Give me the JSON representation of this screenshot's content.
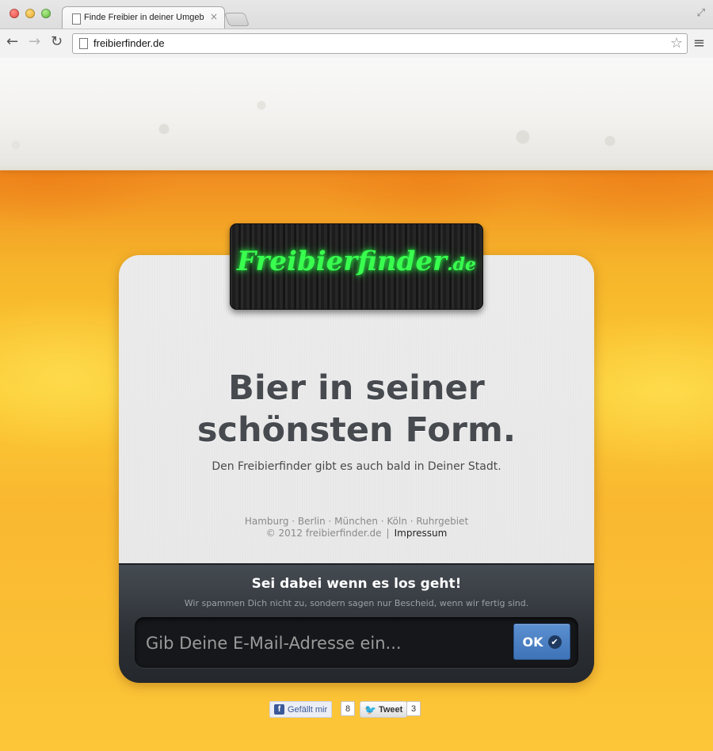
{
  "browser": {
    "tab_title": "Finde Freibier in deiner Umgebung",
    "tab_close": "×",
    "url": "freibierfinder.de"
  },
  "logo": {
    "name": "Freibierfinder",
    "tld": ".de",
    "color": "#39ff4f"
  },
  "hero": {
    "headline_line1": "Bier in seiner",
    "headline_line2": "schönsten Form.",
    "subline": "Den Freibierfinder gibt es auch bald in Deiner Stadt."
  },
  "footer": {
    "cities": "Hamburg · Berlin · München · Köln · Ruhrgebiet",
    "copyright": "© 2012 freibierfinder.de",
    "separator": "|",
    "impressum": "Impressum"
  },
  "signup": {
    "title": "Sei dabei wenn es los geht!",
    "subtitle": "Wir spammen Dich nicht zu, sondern sagen nur Bescheid, wenn wir fertig sind.",
    "email_placeholder": "Gib Deine E-Mail-Adresse ein...",
    "ok_label": "OK",
    "ok_color": "#4a80c4"
  },
  "social": {
    "facebook_label": "Gefällt mir",
    "facebook_count": "8",
    "twitter_label": "Tweet",
    "twitter_count": "3"
  }
}
